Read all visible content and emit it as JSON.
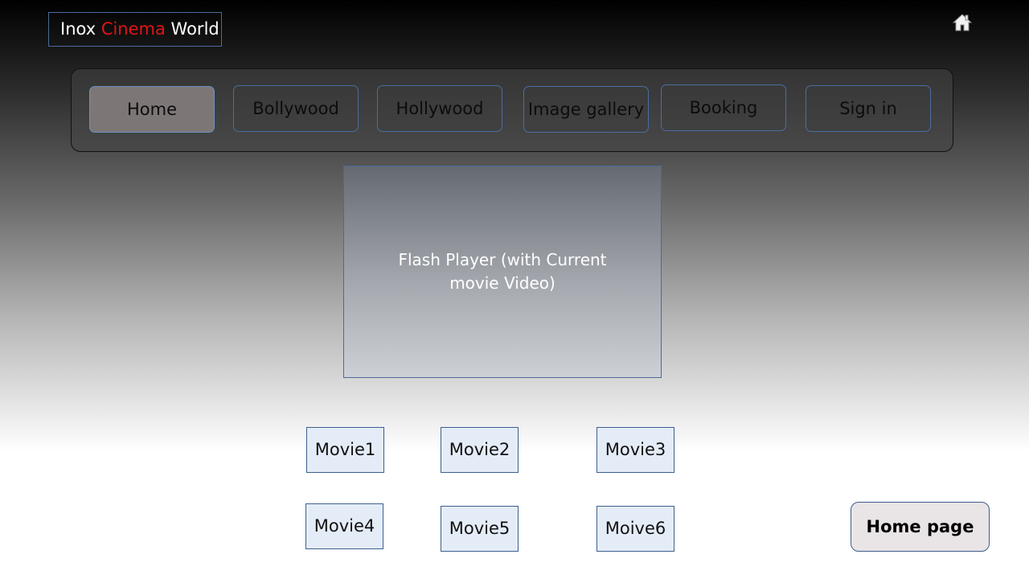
{
  "logo": {
    "part1": "Inox ",
    "part2": "Cinema",
    "part3": " World",
    "accent_color": "#e01515"
  },
  "header": {
    "home_icon": "home-icon"
  },
  "nav": {
    "items": [
      {
        "label": "Home",
        "active": true
      },
      {
        "label": "Bollywood"
      },
      {
        "label": "Hollywood"
      },
      {
        "label": "Image gallery"
      },
      {
        "label": "Booking"
      },
      {
        "label": "Sign in"
      }
    ]
  },
  "player": {
    "text": "Flash Player (with Current movie Video)"
  },
  "movies": [
    "Movie1",
    "Movie2",
    "Movie3",
    "Movie4",
    "Movie5",
    "Moive6"
  ],
  "footer": {
    "home_page_label": "Home page"
  }
}
